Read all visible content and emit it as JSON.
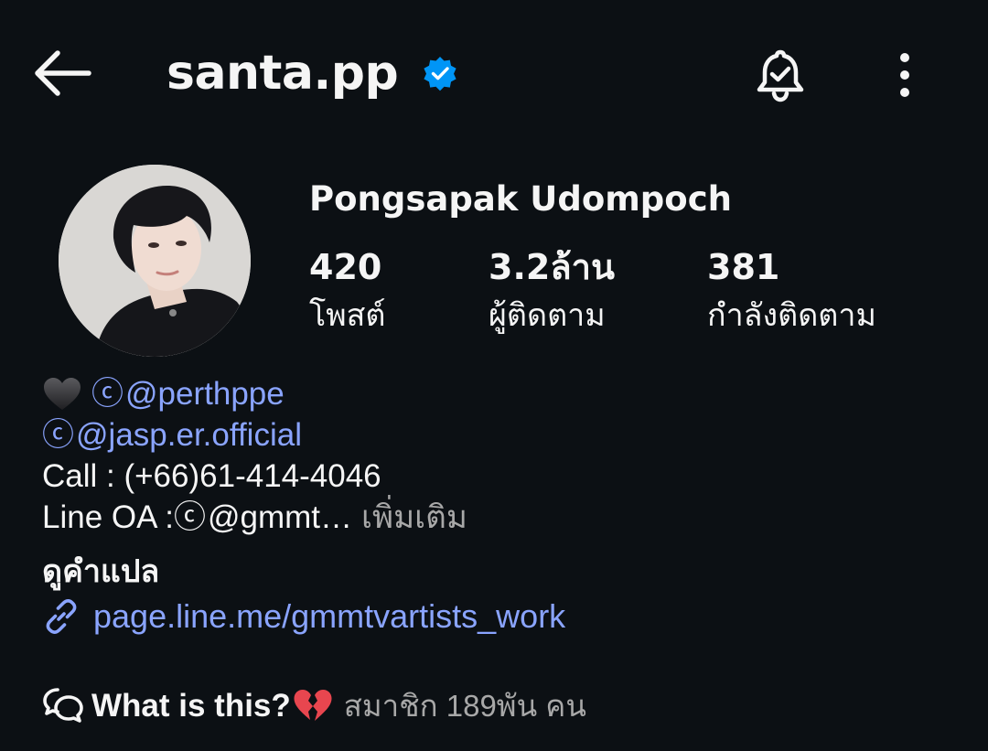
{
  "header": {
    "username": "santa.pp",
    "verified": true,
    "back_icon": "arrow-left-icon",
    "notification_icon": "bell-check-icon",
    "more_icon": "more-vertical-icon"
  },
  "profile": {
    "full_name": "Pongsapak Udompoch",
    "stats": [
      {
        "value": "420",
        "label": "โพสต์"
      },
      {
        "value": "3.2ล้าน",
        "label": "ผู้ติดตาม"
      },
      {
        "value": "381",
        "label": "กำลังติดตาม"
      }
    ]
  },
  "bio": {
    "line1_handle": "@perthppe",
    "line2_handle": "@jasp.er.official",
    "line3": "Call : (+66)61-414-4046",
    "line4_prefix": "Line OA : ",
    "line4_handle": "@gmmt…",
    "more_label": "เพิ่มเติม",
    "threads_glyph": "ⓒ"
  },
  "translate_label": "ดูคำแปล",
  "website": {
    "url": "page.line.me/gmmtvartists_work",
    "icon": "link-icon"
  },
  "community": {
    "name": "What is this?",
    "members": "สมาชิก 189พัน คน",
    "icon": "chat-bubbles-icon",
    "emoji_icon": "broken-heart-icon"
  },
  "colors": {
    "background": "#0c1014",
    "text": "#f5f5f5",
    "link": "#8aa4ff",
    "muted": "#a8a8a8",
    "verified": "#0095f6"
  }
}
